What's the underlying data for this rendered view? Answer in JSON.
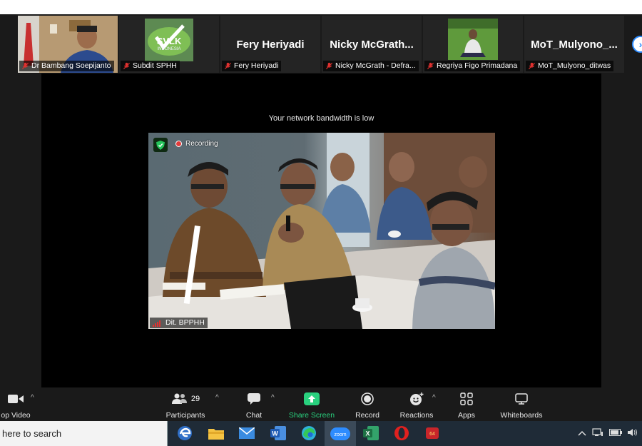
{
  "participants_gallery": [
    {
      "name_big": "",
      "caption": "Dr Bambang Soepijanto",
      "has_video": true
    },
    {
      "name_big": "",
      "caption": "Subdit SPHH",
      "has_video": true,
      "logo_text": "SVLK",
      "logo_sub": "INDONESIA"
    },
    {
      "name_big": "Fery Heriyadi",
      "caption": "Fery Heriyadi",
      "has_video": false
    },
    {
      "name_big": "Nicky  McGrath...",
      "caption": "Nicky McGrath - Defra...",
      "has_video": false
    },
    {
      "name_big": "",
      "caption": "Regriya Figo Primadana",
      "has_video": true
    },
    {
      "name_big": "MoT_Mulyono_...",
      "caption": "MoT_Mulyono_ditwas",
      "has_video": false
    }
  ],
  "gallery_next_icon": "chevron-right-icon",
  "stage": {
    "warning": "Your network bandwidth is low",
    "recording_label": "Recording",
    "speaker_caption": "Dit. BPPHH"
  },
  "toolbar": {
    "video_label": "op Video",
    "participants_label": "Participants",
    "participants_count": "29",
    "chat_label": "Chat",
    "share_label": "Share Screen",
    "record_label": "Record",
    "reactions_label": "Reactions",
    "apps_label": "Apps",
    "whiteboards_label": "Whiteboards"
  },
  "taskbar": {
    "search_text": " here to search",
    "apps": [
      "edge-legacy-icon",
      "file-explorer-icon",
      "mail-icon",
      "word-icon",
      "edge-icon",
      "zoom-icon",
      "excel-icon",
      "opera-icon",
      "app-red-icon"
    ],
    "active_app": "zoom-icon",
    "zoom_icon_text": "zoom",
    "app_red_badge": "64"
  },
  "colors": {
    "share_green": "#29d17e",
    "accent_blue": "#2d8cff",
    "mic_muted_red": "#e0312f"
  }
}
